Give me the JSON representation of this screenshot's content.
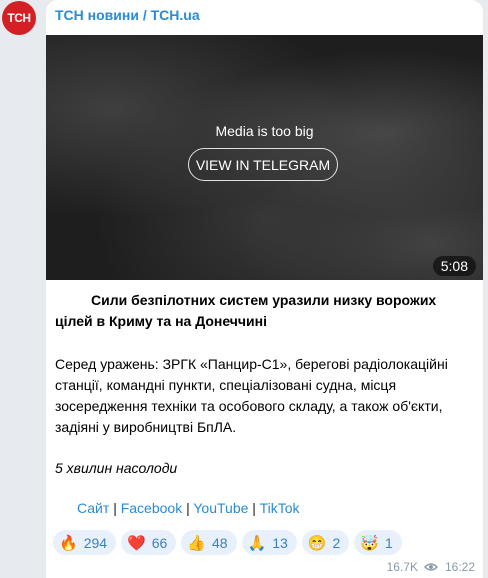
{
  "channel": {
    "name": "ТСН новини / TCH.ua",
    "avatar_text": "ТСН",
    "avatar_color": "#d41f25"
  },
  "media": {
    "message": "Media is too big",
    "button_label": "VIEW IN TELEGRAM",
    "duration": "5:08"
  },
  "post": {
    "headline": "Сили безпілотних систем уразили низку ворожих цілей в Криму та на Донеччині",
    "body": "Серед уражень: ЗРГК «Панцир-С1», берегові радіолокаційні станції, командні пункти, спеціалізовані судна, місця зосередження техніки та особового складу, а також об'єкти, задіяні у виробництві БпЛА.",
    "tagline": "5 хвилин насолоди"
  },
  "links": {
    "site": "Сайт",
    "facebook": "Facebook",
    "youtube": "YouTube",
    "tiktok": "TikTok",
    "separator": "|"
  },
  "reactions": [
    {
      "emoji": "🔥",
      "count": "294"
    },
    {
      "emoji": "❤️",
      "count": "66"
    },
    {
      "emoji": "👍",
      "count": "48"
    },
    {
      "emoji": "🙏",
      "count": "13"
    },
    {
      "emoji": "😁",
      "count": "2"
    },
    {
      "emoji": "🤯",
      "count": "1"
    }
  ],
  "meta": {
    "views": "16.7K",
    "time": "16:22",
    "view_icon": "eye-icon"
  },
  "colors": {
    "link": "#2a8bd3",
    "reaction_bg": "#e8f1fb",
    "reaction_text": "#3b7fc4",
    "background": "#e7ebf0"
  }
}
